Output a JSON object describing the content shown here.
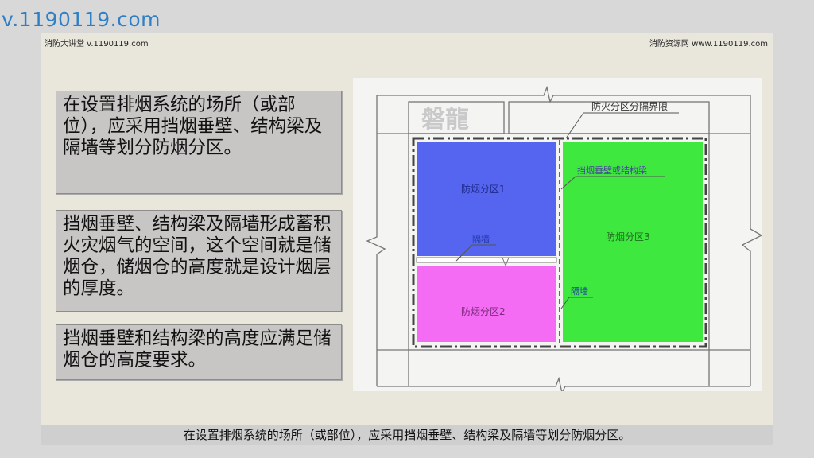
{
  "corner_url": "v.1190119.com",
  "header": {
    "left": "消防大讲堂 v.1190119.com",
    "right": "消防资源网 www.1190119.com"
  },
  "text_boxes": [
    "在设置排烟系统的场所（或部位），应采用挡烟垂壁、结构梁及隔墙等划分防烟分区。",
    "挡烟垂壁、结构梁及隔墙形成蓄积火灾烟气的空间，这个空间就是储烟仓，储烟仓的高度就是设计烟层的厚度。",
    "挡烟垂壁和结构梁的高度应满足储烟仓的高度要求。"
  ],
  "diagram": {
    "watermark": "磐龍",
    "fire_compartment_label": "防火分区分隔界限",
    "smoke_barrier_label": "挡烟垂壁或结构梁",
    "partition_wall_label_1": "隔墙",
    "partition_wall_label_2": "隔墙",
    "zone1": "防烟分区1",
    "zone2": "防烟分区2",
    "zone3": "防烟分区3",
    "colors": {
      "zone1": "#5565f0",
      "zone2": "#f36cf3",
      "zone3": "#3fe83f"
    }
  },
  "bottom_caption": "在设置排烟系统的场所（或部位），应采用挡烟垂壁、结构梁及隔墙等划分防烟分区。"
}
